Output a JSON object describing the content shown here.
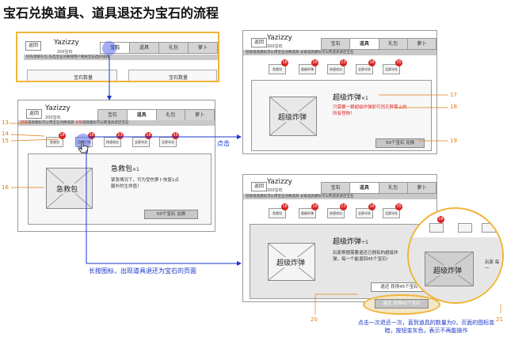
{
  "title": "宝石兑换道具、道具退还为宝石的流程",
  "app": {
    "brand": "Yazizzy",
    "gems": "200宝石",
    "back": "返回",
    "tabs": [
      "宝石",
      "道具",
      "礼包",
      "萝卜"
    ]
  },
  "screen1": {
    "notice": "好先领取礼包,先选宝石兑换或用户相关宝石选好道具",
    "label_left": "宝石数量",
    "label_right": "宝石数量"
  },
  "screen2": {
    "notice_red": "轻按",
    "notice_text": "道具图标可以用宝石兑换道具",
    "notice_red2": "长按",
    "notice_text2": "道具图标可以把道具退还宝石",
    "items": [
      {
        "label": "急救包",
        "count": "18"
      },
      {
        "label": "超级炸弹",
        "count": "16"
      },
      {
        "label": "快速攻击",
        "count": "23"
      },
      {
        "label": "全屏冰冻",
        "count": "18"
      },
      {
        "label": "全屏冰冻",
        "count": "35"
      }
    ],
    "image_label": "急救包",
    "name": "急救包",
    "qty": "×1",
    "desc": "紧急情况下，可为受伤萝卜恢复1点额外的生命值！",
    "button": "50个宝石 兑换"
  },
  "screen3": {
    "notice": "轻按道具图标可以用宝石兑换道具 长按道具图标可以把道具退还宝石",
    "items": [
      {
        "label": "急救包",
        "count": "18"
      },
      {
        "label": "超级炸弹",
        "count": "16"
      },
      {
        "label": "快速攻击",
        "count": "23"
      },
      {
        "label": "全屏冰冻",
        "count": "18"
      },
      {
        "label": "全屏冰冻",
        "count": "35"
      }
    ],
    "image_label": "超级炸弹",
    "name": "超级炸弹",
    "qty": "×1",
    "desc": "只需要一颗超级炸弹即可消灭屏幕上的所有怪物！",
    "button": "50个宝石 兑换"
  },
  "screen4": {
    "notice": "轻按道具图标可以用宝石兑换道具 长按道具图标可以把道具退还宝石",
    "items": [
      {
        "label": "急救包",
        "count": "18"
      },
      {
        "label": "超级炸弹",
        "count": "16"
      },
      {
        "label": "快速攻击",
        "count": "23"
      },
      {
        "label": "全屏冰冻",
        "count": "18"
      },
      {
        "label": "全屏冰冻",
        "count": "35"
      }
    ],
    "image_label": "超级炸弹",
    "name": "超级炸弹",
    "qty": "÷1",
    "desc": "玩家根据需要退还已拥有的超级炸弹，每一个能退回45个宝石!",
    "refund_button": "退还 获得45个宝石",
    "refund_button_gray": "退还 获得45个宝石"
  },
  "zoom": {
    "badge": "18",
    "image_label": "超级炸弹",
    "side_text": "玩家 每一"
  },
  "callouts": {
    "n13": "13",
    "n14": "14",
    "n15": "15",
    "n16": "16",
    "n17": "17",
    "n18": "18",
    "n19": "19",
    "n20": "20",
    "n21": "21"
  },
  "annotations": {
    "tap": "点击",
    "long_press": "长按图标，出现道具退还为宝石的页面",
    "note": "点击一次退还一次，直到道具的数量为0，页面的图标变暗，按钮变灰色，表示不再能操作"
  },
  "colors": {
    "arrow": "#1a35c8",
    "number": "#e07b14",
    "badge": "#d82020",
    "frame_highlight": "#f0b43a"
  }
}
